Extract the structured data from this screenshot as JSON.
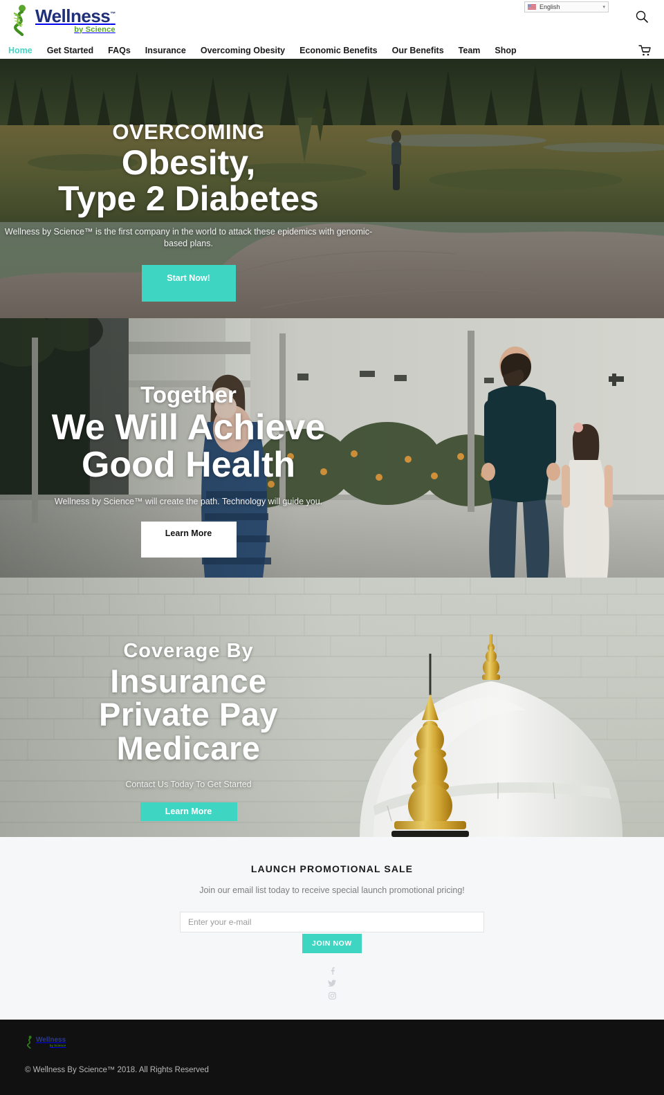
{
  "header": {
    "logo": {
      "main": "Wellness",
      "tm": "™",
      "sub": "by Science",
      "icon": "dna-helix-icon"
    },
    "language": {
      "label": "English",
      "flag_icon": "us-flag-icon",
      "caret_icon": "chevron-down-icon"
    },
    "search_icon": "search-icon",
    "cart_icon": "shopping-cart-icon"
  },
  "nav": {
    "items": [
      {
        "label": "Home",
        "active": true
      },
      {
        "label": "Get Started",
        "active": false
      },
      {
        "label": "FAQs",
        "active": false
      },
      {
        "label": "Insurance",
        "active": false
      },
      {
        "label": "Overcoming Obesity",
        "active": false
      },
      {
        "label": "Economic Benefits",
        "active": false
      },
      {
        "label": "Our Benefits",
        "active": false
      },
      {
        "label": "Team",
        "active": false
      },
      {
        "label": "Shop",
        "active": false
      }
    ]
  },
  "heroes": [
    {
      "eyebrow": "OVERCOMING",
      "title_line1": "Obesity,",
      "title_line2": "Type 2 Diabetes",
      "subtitle": "Wellness by Science™ is the first company in the world to attack these epidemics with genomic-based plans.",
      "cta": "Start Now!",
      "cta_style": "teal",
      "image_description": "mountain-meadow-with-pine-forest"
    },
    {
      "eyebrow": "Together",
      "title_line1": "We Will Achieve",
      "title_line2": "Good Health",
      "subtitle": "Wellness by Science™ will create the path. Technology will guide you.",
      "cta": "Learn More",
      "cta_style": "white",
      "image_description": "family-walking-outdoors"
    },
    {
      "eyebrow": "Coverage By",
      "title_line1": "Insurance",
      "title_line2": "Private Pay",
      "title_line3": "Medicare",
      "subtitle": "Contact Us Today To Get Started",
      "cta": "Learn More",
      "cta_style": "teal",
      "image_description": "white-mosque-dome-with-gold-finials"
    }
  ],
  "promo": {
    "heading": "LAUNCH PROMOTIONAL SALE",
    "description": "Join our email list today to receive special launch promotional pricing!",
    "email_placeholder": "Enter your e-mail",
    "email_value": "",
    "join_label": "JOIN NOW",
    "socials": [
      {
        "name": "facebook-icon"
      },
      {
        "name": "twitter-icon"
      },
      {
        "name": "instagram-icon"
      }
    ]
  },
  "footer": {
    "logo": {
      "main": "Wellness",
      "sub": "by Science",
      "icon": "dna-helix-icon"
    },
    "copyright": "© Wellness By Science™ 2018. All Rights Reserved"
  },
  "colors": {
    "accent_teal": "#3fd5c3",
    "logo_blue": "#1f2f7a",
    "logo_green": "#5aa52b",
    "promo_bg": "#f6f7f9",
    "footer_bg": "#111111"
  }
}
